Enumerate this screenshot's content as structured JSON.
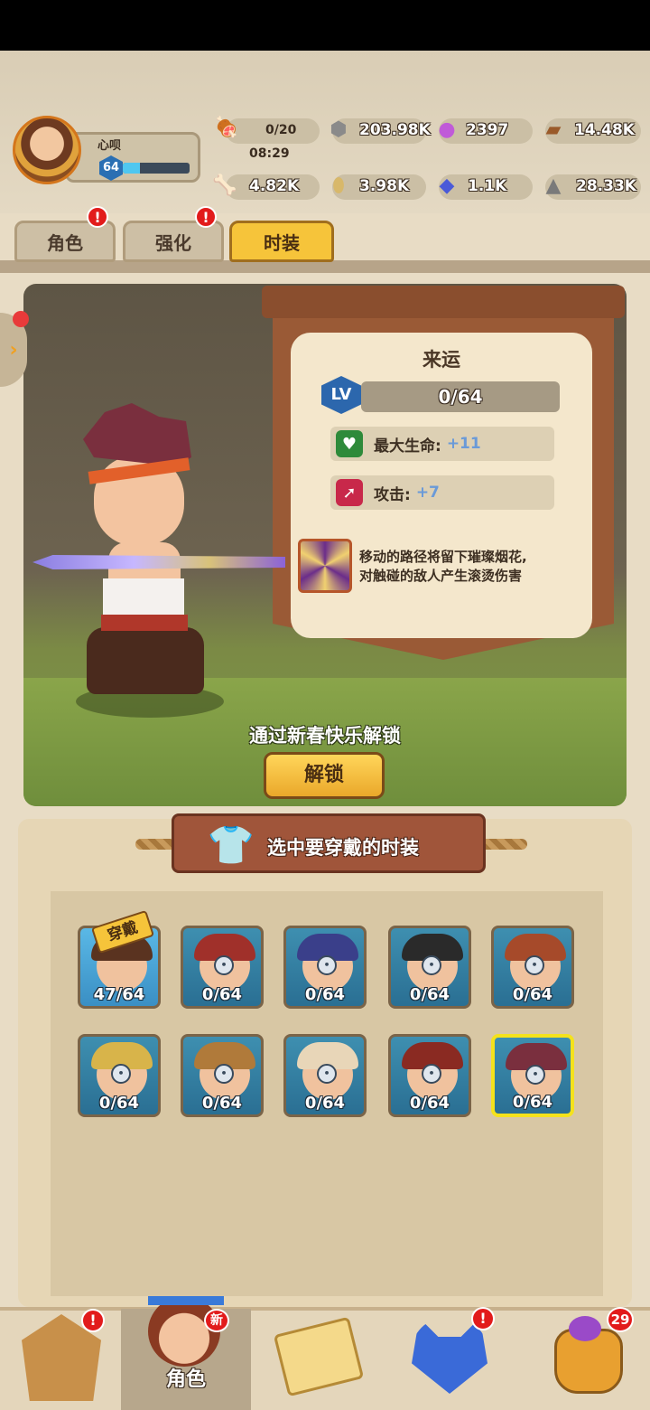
{
  "player": {
    "name": "心呗",
    "level": "64",
    "xp_fraction": 0.25
  },
  "resources": {
    "stamina": {
      "value": "0/20",
      "timer": "08:29"
    },
    "nuts": "203.98K",
    "gems_purple": "2397",
    "wood": "14.48K",
    "bone": "4.82K",
    "egg": "3.98K",
    "crystal": "1.1K",
    "stone": "28.33K"
  },
  "tabs": [
    {
      "label": "角色",
      "alert": "!"
    },
    {
      "label": "强化",
      "alert": "!"
    },
    {
      "label": "时装",
      "active": true
    }
  ],
  "outfit": {
    "name": "来运",
    "lv_label": "LV",
    "level_progress": "0/64",
    "stats": [
      {
        "label": "最大生命:",
        "bonus": "+11"
      },
      {
        "label": "攻击:",
        "bonus": "+7"
      }
    ],
    "skill_desc_line1": "移动的路径将留下璀璨烟花,",
    "skill_desc_line2": "对触碰的敌人产生滚烫伤害",
    "unlock_hint": "通过新春快乐解锁",
    "unlock_button": "解锁"
  },
  "selection": {
    "title": "选中要穿戴的时装",
    "equipped_tag": "穿戴",
    "skins": [
      {
        "progress": "47/64",
        "hair": "#5a3320",
        "locked": false
      },
      {
        "progress": "0/64",
        "hair": "#a0302a",
        "locked": true
      },
      {
        "progress": "0/64",
        "hair": "#3a3f8a",
        "locked": true
      },
      {
        "progress": "0/64",
        "hair": "#2a2a2a",
        "locked": true
      },
      {
        "progress": "0/64",
        "hair": "#a64a2a",
        "locked": true
      },
      {
        "progress": "0/64",
        "hair": "#d8b44a",
        "locked": true
      },
      {
        "progress": "0/64",
        "hair": "#b07a3a",
        "locked": true
      },
      {
        "progress": "0/64",
        "hair": "#e8d6b8",
        "locked": true
      },
      {
        "progress": "0/64",
        "hair": "#8a2a22",
        "locked": true
      },
      {
        "progress": "0/64",
        "hair": "#7a2f3e",
        "locked": true
      }
    ]
  },
  "bottom_nav": {
    "active_label": "角色",
    "new_badge": "新",
    "alert1": "!",
    "alert2": "!",
    "bag_count": "29"
  },
  "colors": {
    "accent": "#f6c43a",
    "alert": "#e21b1b",
    "selected_border": "#f4e21c"
  }
}
